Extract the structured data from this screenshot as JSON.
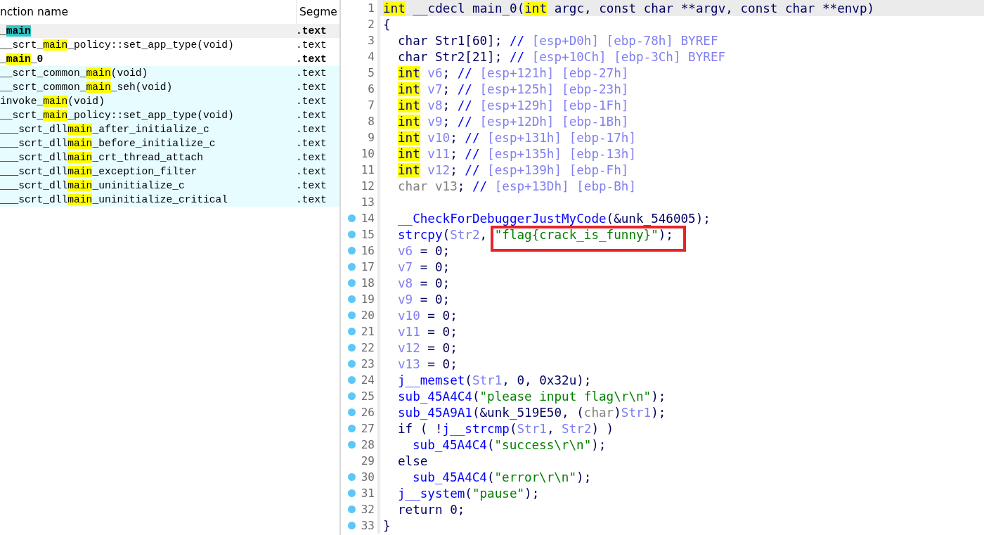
{
  "functions_panel": {
    "columns": [
      "nction name",
      "Segme"
    ],
    "rows": [
      {
        "parts": [
          {
            "text": "_",
            "hit": false
          },
          {
            "text": "main",
            "hit": true
          }
        ],
        "segment": ".text",
        "selected": true,
        "bold": true,
        "library": false
      },
      {
        "parts": [
          {
            "text": "__scrt_",
            "hit": false
          },
          {
            "text": "main",
            "hit": true
          },
          {
            "text": "_policy::set_app_type(void)",
            "hit": false
          }
        ],
        "segment": ".text",
        "selected": false,
        "bold": false,
        "library": false
      },
      {
        "parts": [
          {
            "text": "_",
            "hit": false
          },
          {
            "text": "main",
            "hit": true
          },
          {
            "text": "_0",
            "hit": false
          }
        ],
        "segment": ".text",
        "selected": false,
        "bold": true,
        "library": false
      },
      {
        "parts": [
          {
            "text": "__scrt_common_",
            "hit": false
          },
          {
            "text": "main",
            "hit": true
          },
          {
            "text": "(void)",
            "hit": false
          }
        ],
        "segment": ".text",
        "selected": false,
        "bold": false,
        "library": true
      },
      {
        "parts": [
          {
            "text": "__scrt_common_",
            "hit": false
          },
          {
            "text": "main",
            "hit": true
          },
          {
            "text": "_seh(void)",
            "hit": false
          }
        ],
        "segment": ".text",
        "selected": false,
        "bold": false,
        "library": true
      },
      {
        "parts": [
          {
            "text": "invoke_",
            "hit": false
          },
          {
            "text": "main",
            "hit": true
          },
          {
            "text": "(void)",
            "hit": false
          }
        ],
        "segment": ".text",
        "selected": false,
        "bold": false,
        "library": true
      },
      {
        "parts": [
          {
            "text": "__scrt_",
            "hit": false
          },
          {
            "text": "main",
            "hit": true
          },
          {
            "text": "_policy::set_app_type(void)",
            "hit": false
          }
        ],
        "segment": ".text",
        "selected": false,
        "bold": false,
        "library": true
      },
      {
        "parts": [
          {
            "text": "___scrt_dll",
            "hit": false
          },
          {
            "text": "main",
            "hit": true
          },
          {
            "text": "_after_initialize_c",
            "hit": false
          }
        ],
        "segment": ".text",
        "selected": false,
        "bold": false,
        "library": true
      },
      {
        "parts": [
          {
            "text": "___scrt_dll",
            "hit": false
          },
          {
            "text": "main",
            "hit": true
          },
          {
            "text": "_before_initialize_c",
            "hit": false
          }
        ],
        "segment": ".text",
        "selected": false,
        "bold": false,
        "library": true
      },
      {
        "parts": [
          {
            "text": "___scrt_dll",
            "hit": false
          },
          {
            "text": "main",
            "hit": true
          },
          {
            "text": "_crt_thread_attach",
            "hit": false
          }
        ],
        "segment": ".text",
        "selected": false,
        "bold": false,
        "library": true
      },
      {
        "parts": [
          {
            "text": "___scrt_dll",
            "hit": false
          },
          {
            "text": "main",
            "hit": true
          },
          {
            "text": "_exception_filter",
            "hit": false
          }
        ],
        "segment": ".text",
        "selected": false,
        "bold": false,
        "library": true
      },
      {
        "parts": [
          {
            "text": "___scrt_dll",
            "hit": false
          },
          {
            "text": "main",
            "hit": true
          },
          {
            "text": "_uninitialize_c",
            "hit": false
          }
        ],
        "segment": ".text",
        "selected": false,
        "bold": false,
        "library": true
      },
      {
        "parts": [
          {
            "text": "___scrt_dll",
            "hit": false
          },
          {
            "text": "main",
            "hit": true
          },
          {
            "text": "_uninitialize_critical",
            "hit": false
          }
        ],
        "segment": ".text",
        "selected": false,
        "bold": false,
        "library": true
      }
    ]
  },
  "code": {
    "lines": [
      {
        "number": "1",
        "kind": "top",
        "selected": true,
        "breakpoint": false,
        "boxed": false,
        "tokens": [
          {
            "kind": "k",
            "text": "int"
          },
          {
            "kind": "p",
            "text": " __cdecl main_0("
          },
          {
            "kind": "k",
            "text": "int"
          },
          {
            "kind": "p",
            "text": " argc, const char **argv, const char **envp)"
          }
        ]
      },
      {
        "number": "2",
        "kind": "top",
        "selected": false,
        "breakpoint": false,
        "boxed": false,
        "tokens": [
          {
            "kind": "p",
            "text": "{"
          }
        ]
      },
      {
        "number": "3",
        "kind": "body",
        "selected": false,
        "breakpoint": false,
        "boxed": false,
        "tokens": [
          {
            "kind": "p",
            "text": "char Str1[60]; "
          },
          {
            "kind": "c",
            "text": "//"
          },
          {
            "kind": "cm",
            "text": " [esp+D0h] [ebp-78h] BYREF"
          }
        ]
      },
      {
        "number": "4",
        "kind": "body",
        "selected": false,
        "breakpoint": false,
        "boxed": false,
        "tokens": [
          {
            "kind": "p",
            "text": "char Str2[21]; "
          },
          {
            "kind": "c",
            "text": "//"
          },
          {
            "kind": "cm",
            "text": " [esp+10Ch] [ebp-3Ch] BYREF"
          }
        ]
      },
      {
        "number": "5",
        "kind": "body",
        "selected": false,
        "breakpoint": false,
        "boxed": false,
        "tokens": [
          {
            "kind": "k",
            "text": "int"
          },
          {
            "kind": "v",
            "text": " v6"
          },
          {
            "kind": "p",
            "text": ";"
          },
          {
            "kind": "c",
            "text": " //"
          },
          {
            "kind": "cm",
            "text": " [esp+121h] [ebp-27h]"
          }
        ]
      },
      {
        "number": "6",
        "kind": "body",
        "selected": false,
        "breakpoint": false,
        "boxed": false,
        "tokens": [
          {
            "kind": "k",
            "text": "int"
          },
          {
            "kind": "v",
            "text": " v7"
          },
          {
            "kind": "p",
            "text": ";"
          },
          {
            "kind": "c",
            "text": " //"
          },
          {
            "kind": "cm",
            "text": " [esp+125h] [ebp-23h]"
          }
        ]
      },
      {
        "number": "7",
        "kind": "body",
        "selected": false,
        "breakpoint": false,
        "boxed": false,
        "tokens": [
          {
            "kind": "k",
            "text": "int"
          },
          {
            "kind": "v",
            "text": " v8"
          },
          {
            "kind": "p",
            "text": ";"
          },
          {
            "kind": "c",
            "text": " //"
          },
          {
            "kind": "cm",
            "text": " [esp+129h] [ebp-1Fh]"
          }
        ]
      },
      {
        "number": "8",
        "kind": "body",
        "selected": false,
        "breakpoint": false,
        "boxed": false,
        "tokens": [
          {
            "kind": "k",
            "text": "int"
          },
          {
            "kind": "v",
            "text": " v9"
          },
          {
            "kind": "p",
            "text": ";"
          },
          {
            "kind": "c",
            "text": " //"
          },
          {
            "kind": "cm",
            "text": " [esp+12Dh] [ebp-1Bh]"
          }
        ]
      },
      {
        "number": "9",
        "kind": "body",
        "selected": false,
        "breakpoint": false,
        "boxed": false,
        "tokens": [
          {
            "kind": "k",
            "text": "int"
          },
          {
            "kind": "v",
            "text": " v10"
          },
          {
            "kind": "p",
            "text": ";"
          },
          {
            "kind": "c",
            "text": " //"
          },
          {
            "kind": "cm",
            "text": " [esp+131h] [ebp-17h]"
          }
        ]
      },
      {
        "number": "10",
        "kind": "body",
        "selected": false,
        "breakpoint": false,
        "boxed": false,
        "tokens": [
          {
            "kind": "k",
            "text": "int"
          },
          {
            "kind": "v",
            "text": " v11"
          },
          {
            "kind": "p",
            "text": ";"
          },
          {
            "kind": "c",
            "text": " //"
          },
          {
            "kind": "cm",
            "text": " [esp+135h] [ebp-13h]"
          }
        ]
      },
      {
        "number": "11",
        "kind": "body",
        "selected": false,
        "breakpoint": false,
        "boxed": false,
        "tokens": [
          {
            "kind": "k",
            "text": "int"
          },
          {
            "kind": "v",
            "text": " v12"
          },
          {
            "kind": "p",
            "text": ";"
          },
          {
            "kind": "c",
            "text": " //"
          },
          {
            "kind": "cm",
            "text": " [esp+139h] [ebp-Fh]"
          }
        ]
      },
      {
        "number": "12",
        "kind": "body",
        "selected": false,
        "breakpoint": false,
        "boxed": false,
        "tokens": [
          {
            "kind": "m",
            "text": "char v13"
          },
          {
            "kind": "p",
            "text": ";"
          },
          {
            "kind": "c",
            "text": " //"
          },
          {
            "kind": "cm",
            "text": " [esp+13Dh] [ebp-Bh]"
          }
        ]
      },
      {
        "number": "13",
        "kind": "top",
        "selected": false,
        "breakpoint": false,
        "boxed": false
      },
      {
        "number": "14",
        "kind": "body",
        "selected": false,
        "breakpoint": true,
        "boxed": false,
        "tokens": [
          {
            "kind": "f",
            "text": "__CheckForDebuggerJustMyCode"
          },
          {
            "kind": "p",
            "text": "(&unk_546005);"
          }
        ]
      },
      {
        "number": "15",
        "kind": "body",
        "selected": false,
        "breakpoint": true,
        "boxed": true,
        "tokens": [
          {
            "kind": "f",
            "text": "strcpy"
          },
          {
            "kind": "p",
            "text": "("
          },
          {
            "kind": "v",
            "text": "Str2"
          },
          {
            "kind": "p",
            "text": ", "
          },
          {
            "kind": "s",
            "text": "\"flag{crack_is_funny}\""
          },
          {
            "kind": "p",
            "text": ");"
          }
        ]
      },
      {
        "number": "16",
        "kind": "body",
        "selected": false,
        "breakpoint": true,
        "boxed": false,
        "tokens": [
          {
            "kind": "v",
            "text": "v6"
          },
          {
            "kind": "p",
            "text": " = 0;"
          }
        ]
      },
      {
        "number": "17",
        "kind": "body",
        "selected": false,
        "breakpoint": true,
        "boxed": false,
        "tokens": [
          {
            "kind": "v",
            "text": "v7"
          },
          {
            "kind": "p",
            "text": " = 0;"
          }
        ]
      },
      {
        "number": "18",
        "kind": "body",
        "selected": false,
        "breakpoint": true,
        "boxed": false,
        "tokens": [
          {
            "kind": "v",
            "text": "v8"
          },
          {
            "kind": "p",
            "text": " = 0;"
          }
        ]
      },
      {
        "number": "19",
        "kind": "body",
        "selected": false,
        "breakpoint": true,
        "boxed": false,
        "tokens": [
          {
            "kind": "v",
            "text": "v9"
          },
          {
            "kind": "p",
            "text": " = 0;"
          }
        ]
      },
      {
        "number": "20",
        "kind": "body",
        "selected": false,
        "breakpoint": true,
        "boxed": false,
        "tokens": [
          {
            "kind": "v",
            "text": "v10"
          },
          {
            "kind": "p",
            "text": " = 0;"
          }
        ]
      },
      {
        "number": "21",
        "kind": "body",
        "selected": false,
        "breakpoint": true,
        "boxed": false,
        "tokens": [
          {
            "kind": "v",
            "text": "v11"
          },
          {
            "kind": "p",
            "text": " = 0;"
          }
        ]
      },
      {
        "number": "22",
        "kind": "body",
        "selected": false,
        "breakpoint": true,
        "boxed": false,
        "tokens": [
          {
            "kind": "v",
            "text": "v12"
          },
          {
            "kind": "p",
            "text": " = 0;"
          }
        ]
      },
      {
        "number": "23",
        "kind": "body",
        "selected": false,
        "breakpoint": true,
        "boxed": false,
        "tokens": [
          {
            "kind": "v",
            "text": "v13"
          },
          {
            "kind": "p",
            "text": " = 0;"
          }
        ]
      },
      {
        "number": "24",
        "kind": "body",
        "selected": false,
        "breakpoint": true,
        "boxed": false,
        "tokens": [
          {
            "kind": "f",
            "text": "j__memset"
          },
          {
            "kind": "p",
            "text": "("
          },
          {
            "kind": "v",
            "text": "Str1"
          },
          {
            "kind": "p",
            "text": ", 0, 0x32u);"
          }
        ]
      },
      {
        "number": "25",
        "kind": "body",
        "selected": false,
        "breakpoint": true,
        "boxed": false,
        "tokens": [
          {
            "kind": "f",
            "text": "sub_45A4C4"
          },
          {
            "kind": "p",
            "text": "("
          },
          {
            "kind": "s",
            "text": "\"please input flag\\r\\n\""
          },
          {
            "kind": "p",
            "text": ");"
          }
        ]
      },
      {
        "number": "26",
        "kind": "body",
        "selected": false,
        "breakpoint": true,
        "boxed": false,
        "tokens": [
          {
            "kind": "f",
            "text": "sub_45A9A1"
          },
          {
            "kind": "p",
            "text": "(&unk_519E50, ("
          },
          {
            "kind": "m",
            "text": "char"
          },
          {
            "kind": "p",
            "text": ")"
          },
          {
            "kind": "v",
            "text": "Str1"
          },
          {
            "kind": "p",
            "text": ");"
          }
        ]
      },
      {
        "number": "27",
        "kind": "body",
        "selected": false,
        "breakpoint": true,
        "boxed": false,
        "tokens": [
          {
            "kind": "p",
            "text": "if ( !"
          },
          {
            "kind": "f",
            "text": "j__strcmp"
          },
          {
            "kind": "p",
            "text": "("
          },
          {
            "kind": "v",
            "text": "Str1"
          },
          {
            "kind": "p",
            "text": ", "
          },
          {
            "kind": "v",
            "text": "Str2"
          },
          {
            "kind": "p",
            "text": ") )"
          }
        ]
      },
      {
        "number": "28",
        "kind": "nested",
        "selected": false,
        "breakpoint": true,
        "boxed": false,
        "tokens": [
          {
            "kind": "f",
            "text": "sub_45A4C4"
          },
          {
            "kind": "p",
            "text": "("
          },
          {
            "kind": "s",
            "text": "\"success\\r\\n\""
          },
          {
            "kind": "p",
            "text": ");"
          }
        ]
      },
      {
        "number": "29",
        "kind": "body",
        "selected": false,
        "breakpoint": false,
        "boxed": false,
        "tokens": [
          {
            "kind": "p",
            "text": "else"
          }
        ]
      },
      {
        "number": "30",
        "kind": "nested",
        "selected": false,
        "breakpoint": true,
        "boxed": false,
        "tokens": [
          {
            "kind": "f",
            "text": "sub_45A4C4"
          },
          {
            "kind": "p",
            "text": "("
          },
          {
            "kind": "s",
            "text": "\"error\\r\\n\""
          },
          {
            "kind": "p",
            "text": ");"
          }
        ]
      },
      {
        "number": "31",
        "kind": "body",
        "selected": false,
        "breakpoint": true,
        "boxed": false,
        "tokens": [
          {
            "kind": "f",
            "text": "j__system"
          },
          {
            "kind": "p",
            "text": "("
          },
          {
            "kind": "s",
            "text": "\"pause\""
          },
          {
            "kind": "p",
            "text": ");"
          }
        ]
      },
      {
        "number": "32",
        "kind": "body",
        "selected": false,
        "breakpoint": true,
        "boxed": false,
        "tokens": [
          {
            "kind": "p",
            "text": "return 0;"
          }
        ]
      },
      {
        "number": "33",
        "kind": "top",
        "selected": false,
        "breakpoint": true,
        "boxed": false,
        "tokens": [
          {
            "kind": "p",
            "text": "}"
          }
        ]
      }
    ]
  }
}
